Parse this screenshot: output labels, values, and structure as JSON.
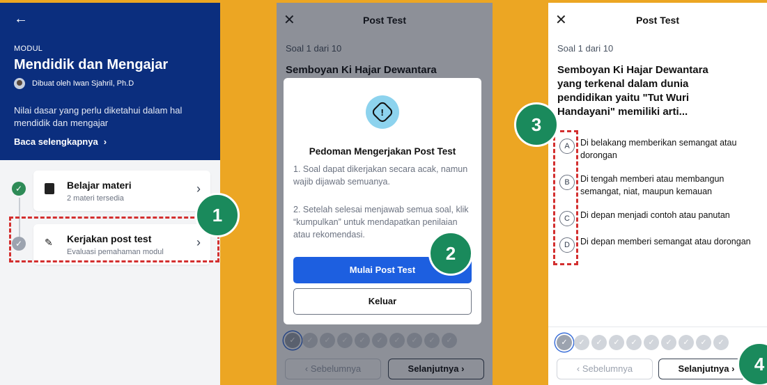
{
  "module": {
    "kicker": "MODUL",
    "title": "Mendidik dan Mengajar",
    "author": "Dibuat oleh Iwan Sjahril, Ph.D",
    "description": "Nilai dasar yang perlu diketahui dalam hal mendidik dan mengajar",
    "read_more": "Baca selengkapnya"
  },
  "steps": [
    {
      "title": "Belajar materi",
      "subtitle": "2 materi tersedia",
      "status": "done"
    },
    {
      "title": "Kerjakan post test",
      "subtitle": "Evaluasi pemahaman modul",
      "status": "todo"
    }
  ],
  "badges": [
    "1",
    "2",
    "3",
    "4"
  ],
  "quiz": {
    "title": "Post Test",
    "counter": "Soal 1 dari 10",
    "question": "Semboyan Ki Hajar Dewantara yang terkenal dalam dunia pendidikan yaitu \"Tut Wuri Handayani\" memiliki arti...",
    "question_truncated": "Semboyan Ki Hajar Dewantara yang",
    "options": [
      {
        "letter": "A",
        "text": "Di belakang memberikan semangat atau dorongan"
      },
      {
        "letter": "B",
        "text": "Di tengah memberi atau membangun semangat, niat, maupun kemauan"
      },
      {
        "letter": "C",
        "text": "Di depan menjadi contoh atau panutan"
      },
      {
        "letter": "D",
        "text": "Di depan memberi semangat atau dorongan"
      }
    ],
    "prev_label": "Sebelumnya",
    "next_label": "Selanjutnya",
    "total_questions": 10,
    "current_question": 1
  },
  "modal": {
    "title": "Pedoman Mengerjakan Post Test",
    "guide_1": "1. Soal dapat dikerjakan secara acak, namun wajib dijawab semuanya.",
    "guide_2": "2. Setelah selesai menjawab semua soal, klik “kumpulkan” untuk mendapatkan penilaian atau rekomendasi.",
    "start_label": "Mulai Post Test",
    "exit_label": "Keluar"
  },
  "colors": {
    "background": "#ECA623",
    "header": "#0B2E7E",
    "primary": "#1D5FE0",
    "success": "#2E8B57",
    "annotation_badge": "#1A8A5C",
    "annotation_dash": "#D32F2F"
  }
}
